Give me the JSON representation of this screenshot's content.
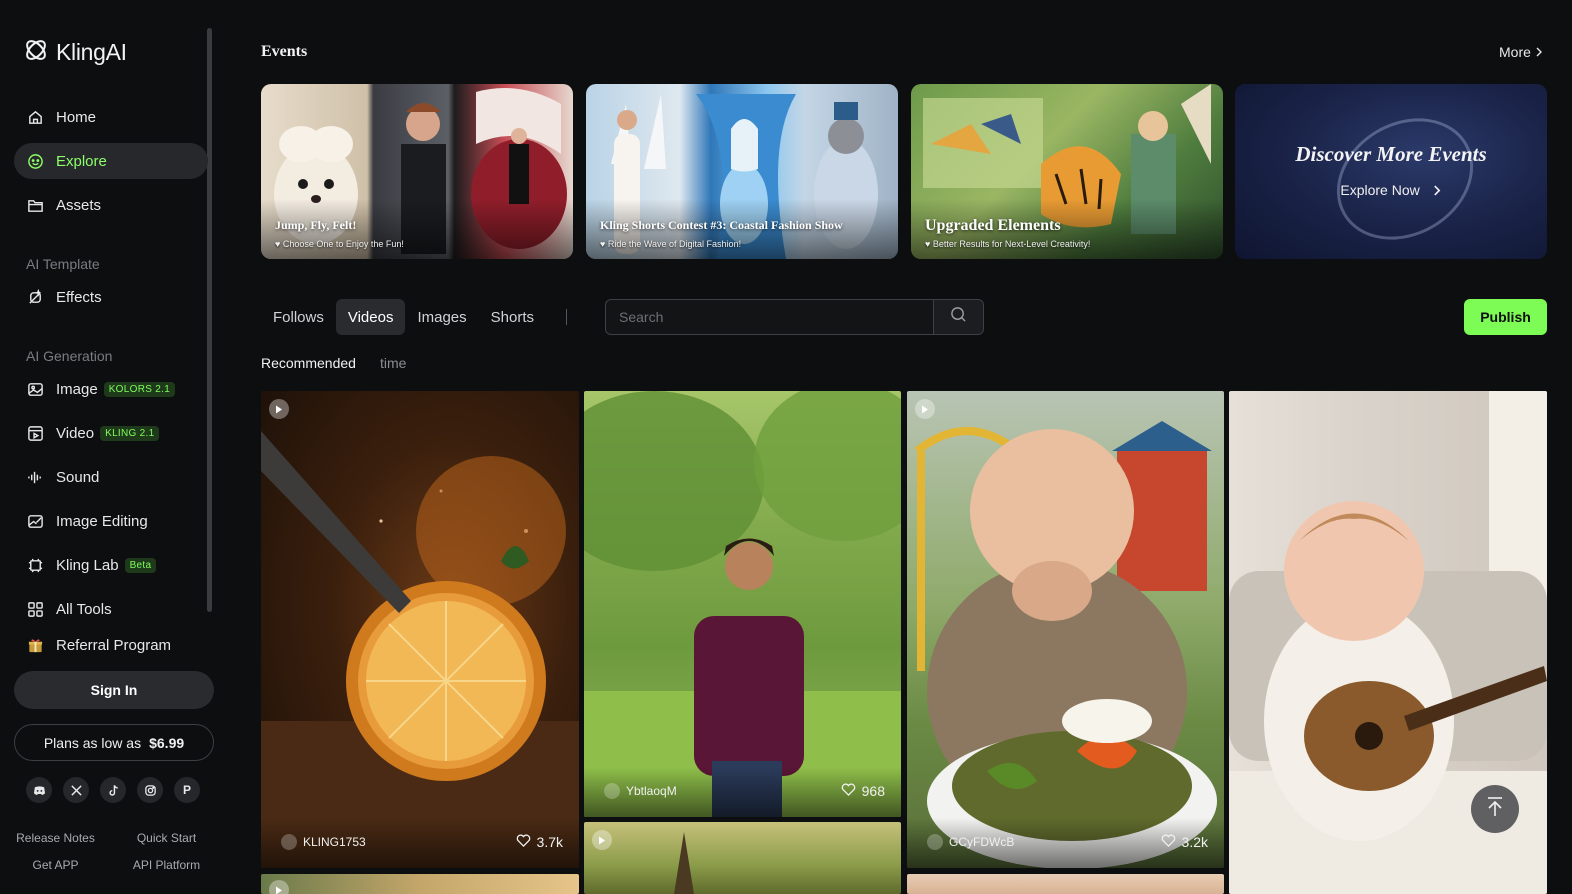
{
  "app": {
    "brand": "KlingAI"
  },
  "sidebar": {
    "nav": [
      {
        "label": "Home",
        "icon": "home-icon"
      },
      {
        "label": "Explore",
        "icon": "explore-icon",
        "active": true
      },
      {
        "label": "Assets",
        "icon": "folder-icon"
      }
    ],
    "sections": {
      "template": "AI Template",
      "generation": "AI Generation"
    },
    "template_items": [
      {
        "label": "Effects",
        "icon": "effects-icon"
      }
    ],
    "generation_items": [
      {
        "label": "Image",
        "icon": "image-icon",
        "badge": "KOLORS 2.1"
      },
      {
        "label": "Video",
        "icon": "video-icon",
        "badge": "KLING 2.1"
      },
      {
        "label": "Sound",
        "icon": "sound-icon"
      },
      {
        "label": "Image Editing",
        "icon": "image-edit-icon"
      },
      {
        "label": "Kling Lab",
        "icon": "lab-icon",
        "badge": "Beta"
      },
      {
        "label": "All Tools",
        "icon": "grid-icon"
      },
      {
        "label": "Referral Program",
        "icon": "gift-icon"
      }
    ],
    "signin": "Sign In",
    "plans": {
      "text": "Plans as low as",
      "price": "$6.99"
    },
    "socials": [
      "discord-icon",
      "x-icon",
      "tiktok-icon",
      "instagram-icon",
      "pinterest-icon"
    ],
    "social_p": "P",
    "footer": [
      "Release Notes",
      "Quick Start",
      "Get APP",
      "API Platform"
    ]
  },
  "events": {
    "title": "Events",
    "more": "More",
    "cards": [
      {
        "title": "Jump, Fly, Felt!",
        "subtitle": "♥ Choose One to Enjoy the Fun!"
      },
      {
        "title": "Kling Shorts Contest #3: Coastal Fashion Show",
        "subtitle": "♥ Ride the Wave of Digital Fashion!"
      },
      {
        "title": "Upgraded Elements",
        "subtitle": "♥ Better Results for Next-Level Creativity!"
      },
      {
        "title": "Discover More Events",
        "cta": "Explore Now"
      }
    ]
  },
  "feed_tabs": [
    "Follows",
    "Videos",
    "Images",
    "Shorts"
  ],
  "active_tab": "Videos",
  "search": {
    "placeholder": "Search",
    "value": ""
  },
  "publish": "Publish",
  "sort_tabs": [
    "Recommended",
    "time"
  ],
  "cards": [
    {
      "user": "KLING1753",
      "likes": "3.7k"
    },
    {
      "user": "YbtlaoqM",
      "likes": "968"
    },
    {
      "user": "GCyFDWcB",
      "likes": "3.2k"
    },
    {
      "user": "",
      "likes": ""
    }
  ],
  "colors": {
    "accent": "#7cfc54",
    "background": "#0d0e10",
    "active_nav_text": "#8dff68"
  }
}
